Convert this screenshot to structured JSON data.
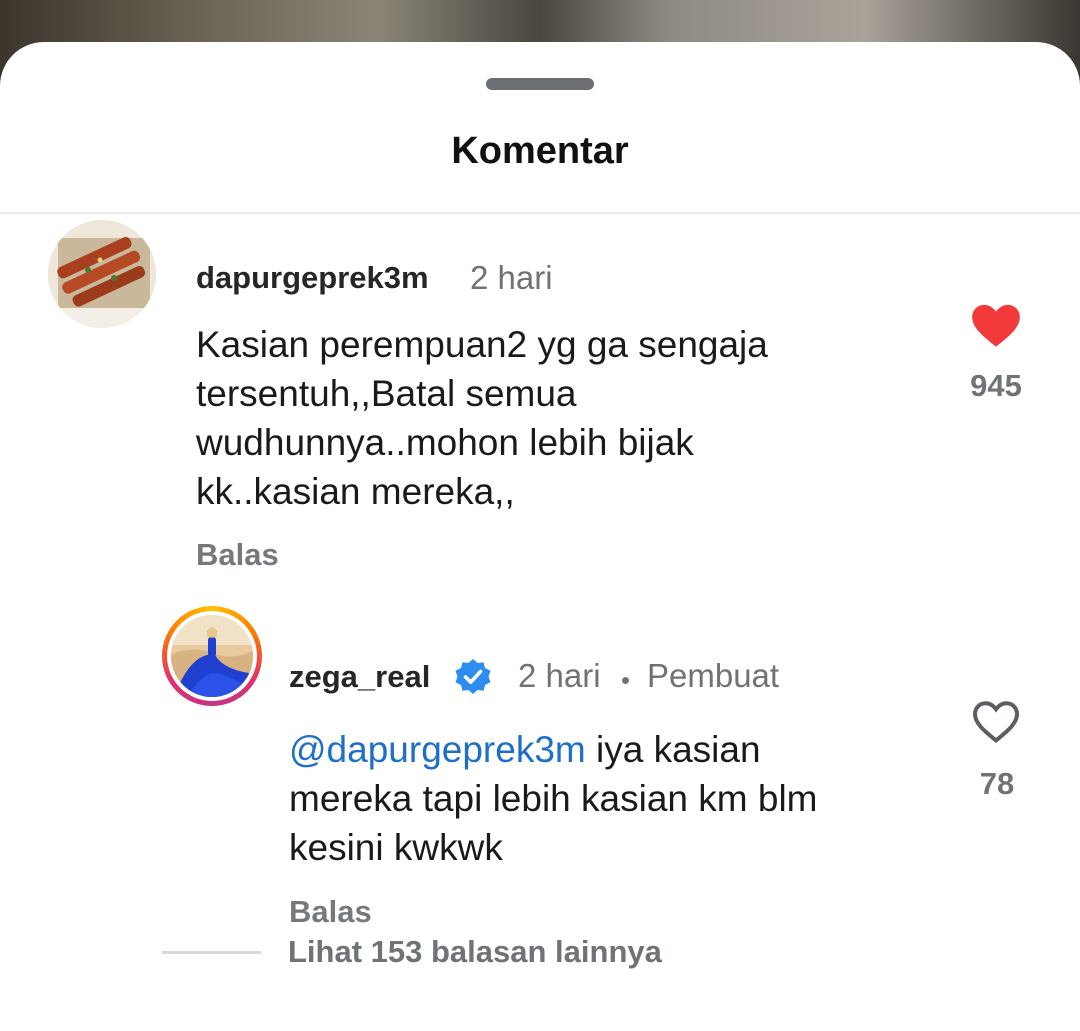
{
  "sheet": {
    "title": "Komentar"
  },
  "comments": [
    {
      "username": "dapurgeprek3m",
      "time": "2 hari",
      "text_lines": [
        "Kasian perempuan2 yg ga sengaja",
        "tersentuh,,Batal semua",
        "wudhunnya..mohon lebih bijak",
        "kk..kasian mereka,,"
      ],
      "reply_label": "Balas",
      "likes": "945",
      "liked": true,
      "avatar_icon": "food-avatar"
    }
  ],
  "reply": {
    "username": "zega_real",
    "verified": true,
    "time": "2 hari",
    "separator": "•",
    "role": "Pembuat",
    "mention": "@dapurgeprek3m",
    "text_line1_rest": " iya kasian",
    "text_line2": "mereka tapi lebih kasian km blm",
    "text_line3": "kesini kwkwk",
    "reply_label": "Balas",
    "likes": "78",
    "liked": false,
    "avatar_icon": "blue-dress-avatar"
  },
  "more_replies": "Lihat 153 balasan lainnya",
  "colors": {
    "heart_liked": "#f23a3a",
    "mention": "#1e6fc9",
    "verified": "#2d8cf0"
  }
}
